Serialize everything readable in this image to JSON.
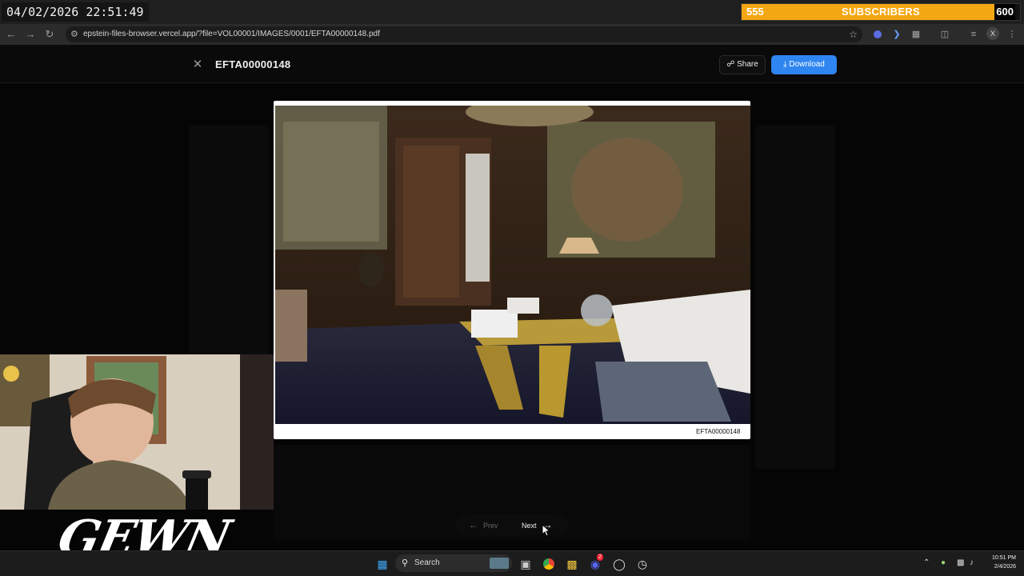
{
  "overlay": {
    "clock": "04/02/2026 22:51:49",
    "subscribers": {
      "current": "555",
      "label": "SUBSCRIBERS",
      "goal": "600",
      "progress": 0.925
    },
    "logo_text": "GEWN"
  },
  "browser": {
    "url": "epstein-files-browser.vercel.app/?file=VOL00001/IMAGES/0001/EFTA00000148.pdf",
    "profile_initial": "X"
  },
  "viewer": {
    "title": "EFTA00000148",
    "share_label": "Share",
    "download_label": "Download",
    "caption": "EFTA00000148",
    "prev_label": "Prev",
    "next_label": "Next",
    "prev_arrow": "←",
    "next_arrow": "→"
  },
  "taskbar": {
    "search_label": "Search",
    "time": "10:51 PM",
    "date": "2/4/2026",
    "discord_badge": "2"
  },
  "colors": {
    "accent": "#2f86f0",
    "subscriber_bar": "#f3a712"
  },
  "icons": {
    "close": "close-icon",
    "share": "share-icon",
    "download": "download-icon",
    "back": "back-arrow-icon",
    "forward": "forward-arrow-icon",
    "reload": "reload-icon",
    "star": "bookmark-star-icon",
    "windows": "windows-start-icon"
  }
}
